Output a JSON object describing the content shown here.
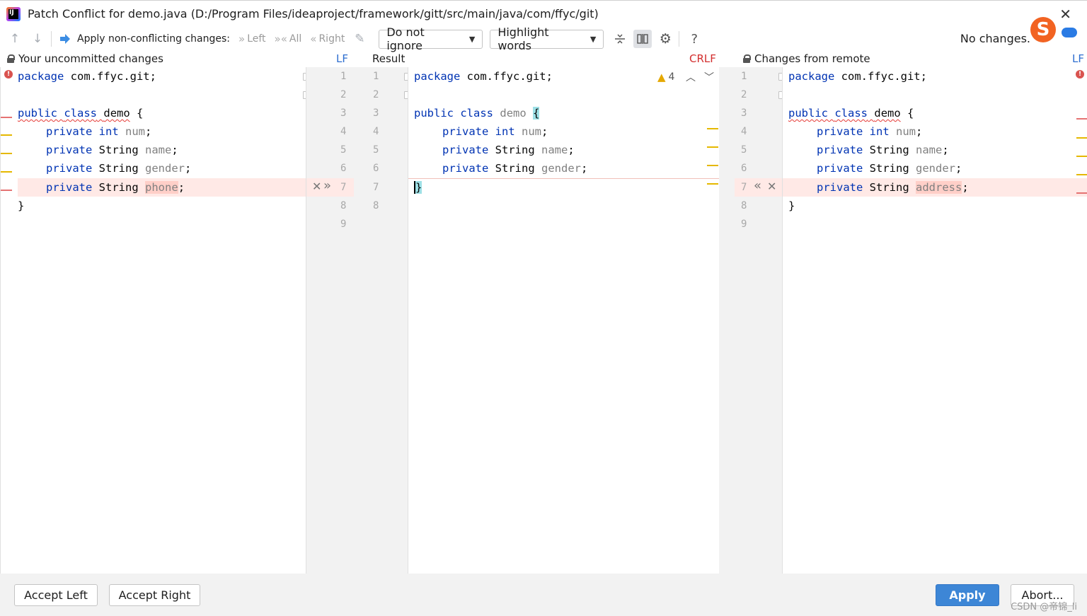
{
  "title": "Patch Conflict for demo.java (D:/Program Files/ideaproject/framework/gitt/src/main/java/com/ffyc/git)",
  "toolbar": {
    "apply_label": "Apply non-conflicting changes:",
    "left": "Left",
    "all": "All",
    "right": "Right",
    "ignore_option": "Do not ignore",
    "highlight_option": "Highlight words",
    "no_changes": "No changes."
  },
  "left_pane": {
    "header": "Your uncommitted changes",
    "encoding": "LF",
    "line_numbers": [
      "1",
      "2",
      "3",
      "4",
      "5",
      "6",
      "7",
      "8",
      "9"
    ]
  },
  "middle_pane": {
    "header": "Result",
    "encoding": "CRLF",
    "warnings": "4",
    "line_numbers": [
      "1",
      "2",
      "3",
      "4",
      "5",
      "6",
      "7",
      "8"
    ]
  },
  "right_pane": {
    "header": "Changes from remote",
    "encoding": "LF",
    "line_numbers": [
      "1",
      "2",
      "3",
      "4",
      "5",
      "6",
      "7",
      "8",
      "9"
    ]
  },
  "code": {
    "package_kw": "package",
    "package_name": " com.ffyc.git;",
    "public_kw": "public",
    "class_kw": "class",
    "class_name": "demo",
    "brace_open": "{",
    "brace_close": "}",
    "private_kw": "private",
    "int_kw": "int",
    "string_type": "String",
    "f_num": "num",
    "f_name": "name",
    "f_gender": "gender",
    "f_phone": "phone",
    "f_address": "address",
    "semi": ";"
  },
  "buttons": {
    "accept_left": "Accept Left",
    "accept_right": "Accept Right",
    "apply": "Apply",
    "abort": "Abort..."
  },
  "watermark": "CSDN @帝锦_li"
}
